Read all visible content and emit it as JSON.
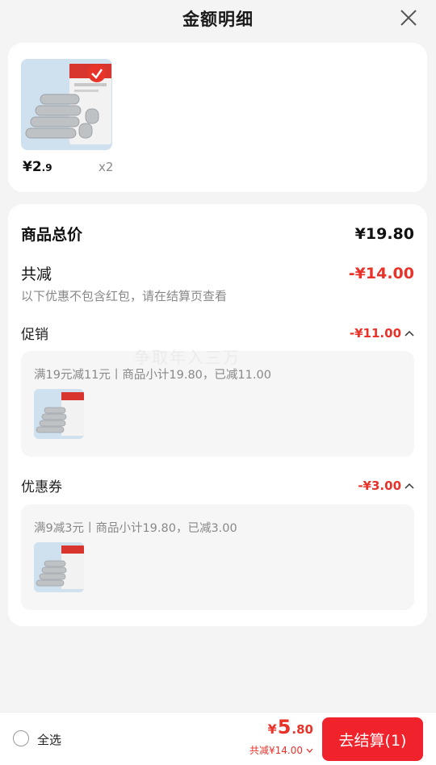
{
  "header": {
    "title": "金额明细"
  },
  "product": {
    "price_main": "¥2",
    "price_dec": ".9",
    "qty": "x2"
  },
  "summary": {
    "total_label": "商品总价",
    "total_value": "¥19.80",
    "reduce_label": "共减",
    "reduce_value": "-¥14.00",
    "note": "以下优惠不包含红包，请在结算页查看",
    "promo": {
      "label": "促销",
      "value": "-¥11.00",
      "desc": "满19元减11元丨商品小计19.80，已减11.00"
    },
    "coupon": {
      "label": "优惠券",
      "value": "-¥3.00",
      "desc": "满9减3元丨商品小计19.80，已减3.00"
    }
  },
  "watermark": "争取年入三万",
  "bottom": {
    "select_all": "全选",
    "currency": "¥",
    "price_int": "5",
    "price_dec": ".80",
    "saved": "共减¥14.00",
    "checkout": "去结算(1)"
  },
  "colors": {
    "accent": "#e8332a",
    "button": "#f0232d"
  },
  "icons": [
    "close-icon",
    "chevron-up-icon",
    "chevron-down-icon",
    "radio-icon"
  ]
}
